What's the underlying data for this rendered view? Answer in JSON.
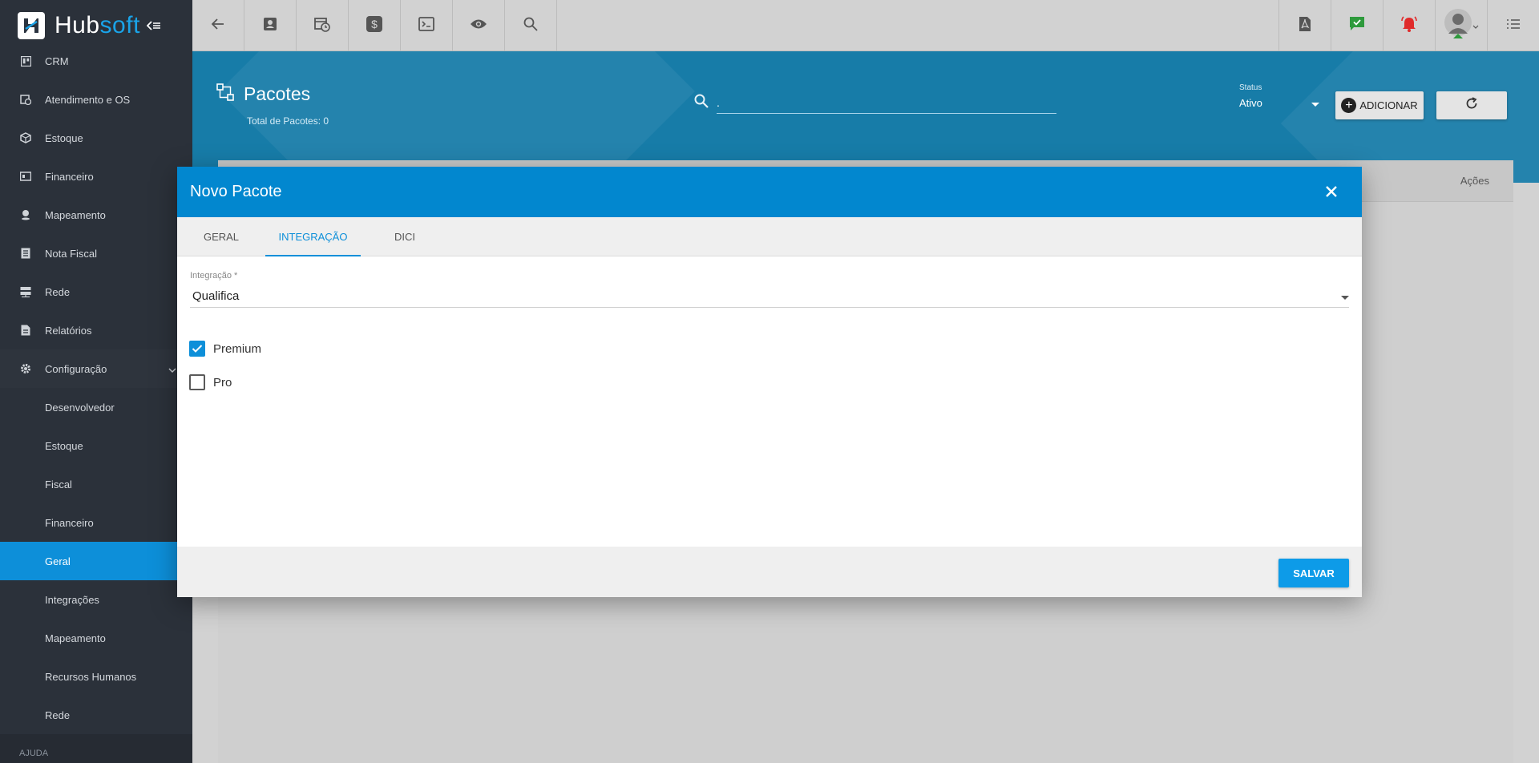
{
  "app": {
    "logo_part1": "Hub",
    "logo_part2": "soft",
    "brand_color": "#1aa3e8"
  },
  "sidebar": {
    "items": [
      {
        "label": "CRM",
        "icon": "trello-board-icon"
      },
      {
        "label": "Atendimento e OS",
        "icon": "calendar-clock-icon"
      },
      {
        "label": "Estoque",
        "icon": "box-icon"
      },
      {
        "label": "Financeiro",
        "icon": "money-icon"
      },
      {
        "label": "Mapeamento",
        "icon": "map-pin-icon"
      },
      {
        "label": "Nota Fiscal",
        "icon": "document-icon"
      },
      {
        "label": "Rede",
        "icon": "server-icon"
      },
      {
        "label": "Relatórios",
        "icon": "report-icon"
      },
      {
        "label": "Configuração",
        "icon": "gear-icon"
      }
    ],
    "sub_items": [
      "Desenvolvedor",
      "Estoque",
      "Fiscal",
      "Financeiro",
      "Geral",
      "Integrações",
      "Mapeamento",
      "Recursos Humanos",
      "Rede"
    ],
    "active_sub": "Geral",
    "section": "AJUDA"
  },
  "page": {
    "title": "Pacotes",
    "subtitle": "Total de Pacotes: 0",
    "search_value": ".",
    "status_label": "Status",
    "status_value": "Ativo",
    "add_label": "ADICIONAR",
    "column_acoes": "Ações"
  },
  "modal": {
    "title": "Novo Pacote",
    "tabs": [
      "GERAL",
      "INTEGRAÇÃO",
      "DICI"
    ],
    "active_tab": "INTEGRAÇÃO",
    "field_label": "Integração *",
    "field_value": "Qualifica",
    "options": [
      {
        "label": "Premium",
        "checked": true
      },
      {
        "label": "Pro",
        "checked": false
      }
    ],
    "save_label": "SALVAR"
  }
}
